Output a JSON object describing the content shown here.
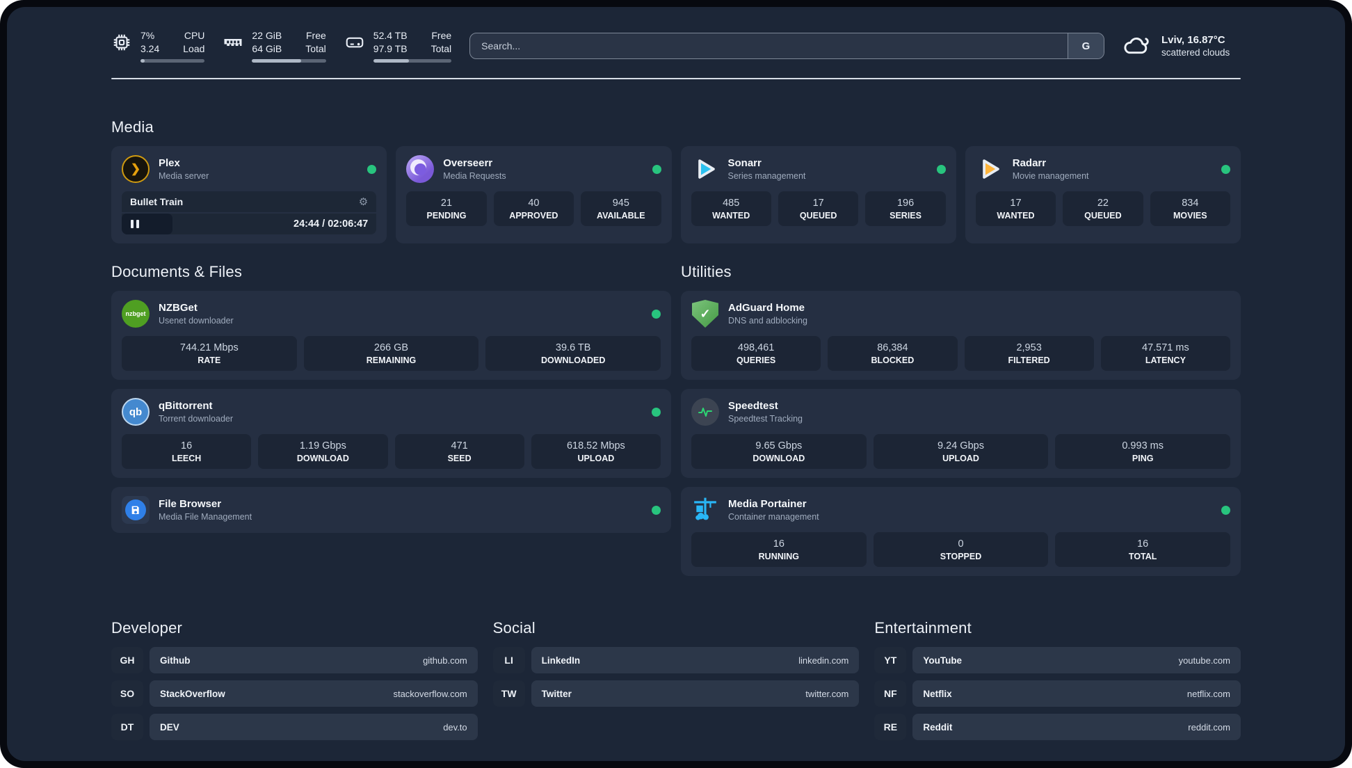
{
  "colors": {
    "status_online": "#28c47e",
    "panel_bg": "#1c2637",
    "card_bg": "#252f42",
    "plex_accent": "#e5a00d"
  },
  "header": {
    "cpu": {
      "value_top": "7%",
      "value_bottom": "3.24",
      "label_top": "CPU",
      "label_bottom": "Load",
      "progress_pct": 7
    },
    "memory": {
      "value_top": "22 GiB",
      "value_bottom": "64 GiB",
      "label_top": "Free",
      "label_bottom": "Total",
      "progress_pct": 66
    },
    "disk": {
      "value_top": "52.4 TB",
      "value_bottom": "97.9 TB",
      "label_top": "Free",
      "label_bottom": "Total",
      "progress_pct": 46
    },
    "search": {
      "placeholder": "Search...",
      "button_label": "G"
    },
    "weather": {
      "location_temp": "Lviv, 16.87°C",
      "condition": "scattered clouds"
    }
  },
  "media": {
    "heading": "Media",
    "plex": {
      "title": "Plex",
      "subtitle": "Media server",
      "now_playing": "Bullet Train",
      "time": "24:44 / 02:06:47",
      "progress_pct": 20
    },
    "overseerr": {
      "title": "Overseerr",
      "subtitle": "Media Requests",
      "stats": [
        {
          "value": "21",
          "label": "PENDING"
        },
        {
          "value": "40",
          "label": "APPROVED"
        },
        {
          "value": "945",
          "label": "AVAILABLE"
        }
      ]
    },
    "sonarr": {
      "title": "Sonarr",
      "subtitle": "Series management",
      "stats": [
        {
          "value": "485",
          "label": "WANTED"
        },
        {
          "value": "17",
          "label": "QUEUED"
        },
        {
          "value": "196",
          "label": "SERIES"
        }
      ]
    },
    "radarr": {
      "title": "Radarr",
      "subtitle": "Movie management",
      "stats": [
        {
          "value": "17",
          "label": "WANTED"
        },
        {
          "value": "22",
          "label": "QUEUED"
        },
        {
          "value": "834",
          "label": "MOVIES"
        }
      ]
    }
  },
  "documents": {
    "heading": "Documents & Files",
    "nzbget": {
      "title": "NZBGet",
      "subtitle": "Usenet downloader",
      "icon_text": "nzbget",
      "stats": [
        {
          "value": "744.21 Mbps",
          "label": "RATE"
        },
        {
          "value": "266 GB",
          "label": "REMAINING"
        },
        {
          "value": "39.6 TB",
          "label": "DOWNLOADED"
        }
      ]
    },
    "qbittorrent": {
      "title": "qBittorrent",
      "subtitle": "Torrent downloader",
      "icon_text": "qb",
      "stats": [
        {
          "value": "16",
          "label": "LEECH"
        },
        {
          "value": "1.19 Gbps",
          "label": "DOWNLOAD"
        },
        {
          "value": "471",
          "label": "SEED"
        },
        {
          "value": "618.52 Mbps",
          "label": "UPLOAD"
        }
      ]
    },
    "filebrowser": {
      "title": "File Browser",
      "subtitle": "Media File Management"
    }
  },
  "utilities": {
    "heading": "Utilities",
    "adguard": {
      "title": "AdGuard Home",
      "subtitle": "DNS and adblocking",
      "stats": [
        {
          "value": "498,461",
          "label": "QUERIES"
        },
        {
          "value": "86,384",
          "label": "BLOCKED"
        },
        {
          "value": "2,953",
          "label": "FILTERED"
        },
        {
          "value": "47.571 ms",
          "label": "LATENCY"
        }
      ]
    },
    "speedtest": {
      "title": "Speedtest",
      "subtitle": "Speedtest Tracking",
      "stats": [
        {
          "value": "9.65 Gbps",
          "label": "DOWNLOAD"
        },
        {
          "value": "9.24 Gbps",
          "label": "UPLOAD"
        },
        {
          "value": "0.993 ms",
          "label": "PING"
        }
      ]
    },
    "portainer": {
      "title": "Media Portainer",
      "subtitle": "Container management",
      "stats": [
        {
          "value": "16",
          "label": "RUNNING"
        },
        {
          "value": "0",
          "label": "STOPPED"
        },
        {
          "value": "16",
          "label": "TOTAL"
        }
      ]
    }
  },
  "bookmarks": {
    "developer": {
      "heading": "Developer",
      "items": [
        {
          "abbr": "GH",
          "name": "Github",
          "url": "github.com"
        },
        {
          "abbr": "SO",
          "name": "StackOverflow",
          "url": "stackoverflow.com"
        },
        {
          "abbr": "DT",
          "name": "DEV",
          "url": "dev.to"
        }
      ]
    },
    "social": {
      "heading": "Social",
      "items": [
        {
          "abbr": "LI",
          "name": "LinkedIn",
          "url": "linkedin.com"
        },
        {
          "abbr": "TW",
          "name": "Twitter",
          "url": "twitter.com"
        }
      ]
    },
    "entertainment": {
      "heading": "Entertainment",
      "items": [
        {
          "abbr": "YT",
          "name": "YouTube",
          "url": "youtube.com"
        },
        {
          "abbr": "NF",
          "name": "Netflix",
          "url": "netflix.com"
        },
        {
          "abbr": "RE",
          "name": "Reddit",
          "url": "reddit.com"
        }
      ]
    }
  }
}
